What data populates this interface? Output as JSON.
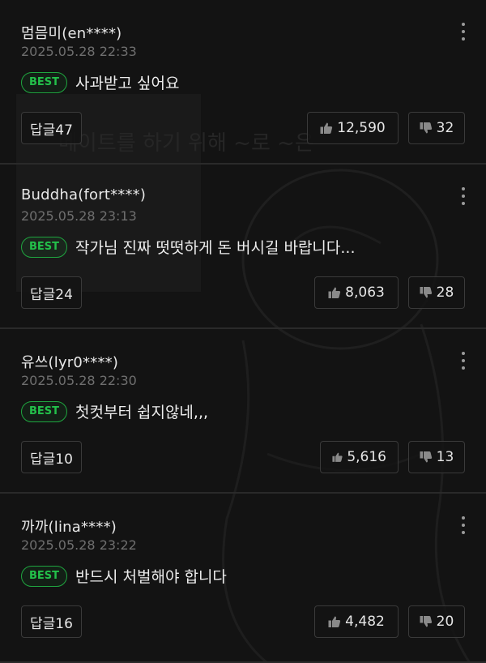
{
  "comments": [
    {
      "author": "멈믐미(en****)",
      "date": "2025.05.28 22:33",
      "badge": "BEST",
      "text": "사과받고 싶어요",
      "reply_label": "답글47",
      "likes": "12,590",
      "dislikes": "32"
    },
    {
      "author": "Buddha(fort****)",
      "date": "2025.05.28 23:13",
      "badge": "BEST",
      "text": "작가님 진짜 떳떳하게 돈 버시길 바랍니다...",
      "reply_label": "답글24",
      "likes": "8,063",
      "dislikes": "28"
    },
    {
      "author": "유쓰(lyr0****)",
      "date": "2025.05.28 22:30",
      "badge": "BEST",
      "text": "첫컷부터 쉽지않네,,,",
      "reply_label": "답글10",
      "likes": "5,616",
      "dislikes": "13"
    },
    {
      "author": "까까(lina****)",
      "date": "2025.05.28 23:22",
      "badge": "BEST",
      "text": "반드시 처벌해야 합니다",
      "reply_label": "답글16",
      "likes": "4,482",
      "dislikes": "20"
    }
  ],
  "background_art_text": "메이트를 하기 위해 ~로 ~은",
  "colors": {
    "background": "#131313",
    "best_green": "#23c04a",
    "text_primary": "#ededed",
    "text_muted": "#6f6f6f"
  },
  "icons": {
    "more": "more-vertical-icon",
    "like": "thumbs-up-icon",
    "dislike": "thumbs-down-icon"
  }
}
